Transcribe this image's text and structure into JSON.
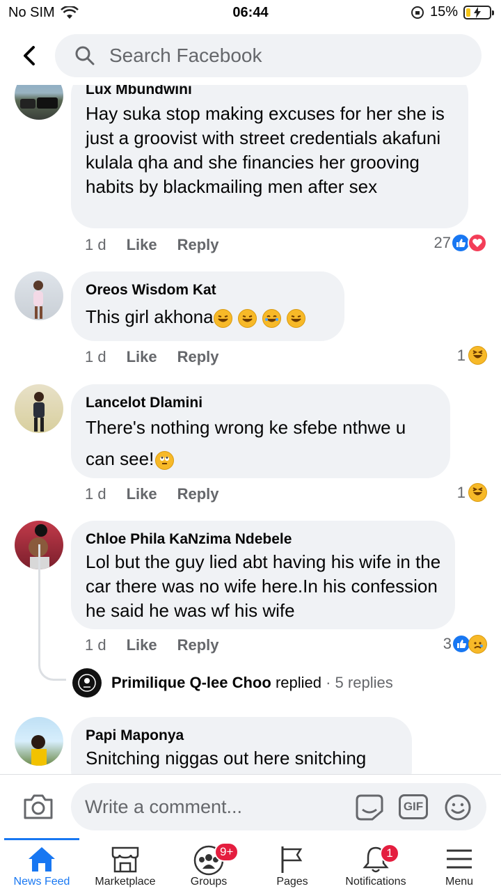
{
  "status": {
    "carrier": "No SIM",
    "time": "06:44",
    "battery": "15%"
  },
  "header": {
    "search_placeholder": "Search Facebook"
  },
  "comments": [
    {
      "name": "Lux Mbundwini",
      "text": "Hay suka stop making excuses for her she is just a groovist with street credentials akafuni kulala qha and she financies her grooving habits by blackmailing men after sex",
      "time": "1 d",
      "like": "Like",
      "reply": "Reply",
      "reactions": "27"
    },
    {
      "name": "Oreos Wisdom Kat",
      "text": "This girl  akhona",
      "time": "1 d",
      "like": "Like",
      "reply": "Reply",
      "reactions": "1"
    },
    {
      "name": "Lancelot Dlamini",
      "text": "There's nothing wrong ke sfebe nthwe u can see!",
      "time": "1 d",
      "like": "Like",
      "reply": "Reply",
      "reactions": "1"
    },
    {
      "name": "Chloe Phila KaNzima Ndebele",
      "text": "Lol but the guy lied abt having his wife in the car there was no wife here.In his confession he said he was wf his wife",
      "time": "1 d",
      "like": "Like",
      "reply": "Reply",
      "reactions": "3",
      "reply_preview": {
        "name": "Primilique Q-lee Choo",
        "action": "replied",
        "meta": "· 5 replies"
      }
    },
    {
      "name": "Papi Maponya",
      "text": "Snitching niggas out here  snitching"
    }
  ],
  "composer": {
    "placeholder": "Write a comment...",
    "gif": "GIF"
  },
  "tabs": [
    {
      "label": "News Feed"
    },
    {
      "label": "Marketplace"
    },
    {
      "label": "Groups",
      "badge": "9+"
    },
    {
      "label": "Pages"
    },
    {
      "label": "Notifications",
      "badge": "1"
    },
    {
      "label": "Menu"
    }
  ],
  "colors": {
    "brand": "#1877f2",
    "bubble": "#f0f2f5",
    "badge": "#e41e3f",
    "muted": "#65676b"
  }
}
